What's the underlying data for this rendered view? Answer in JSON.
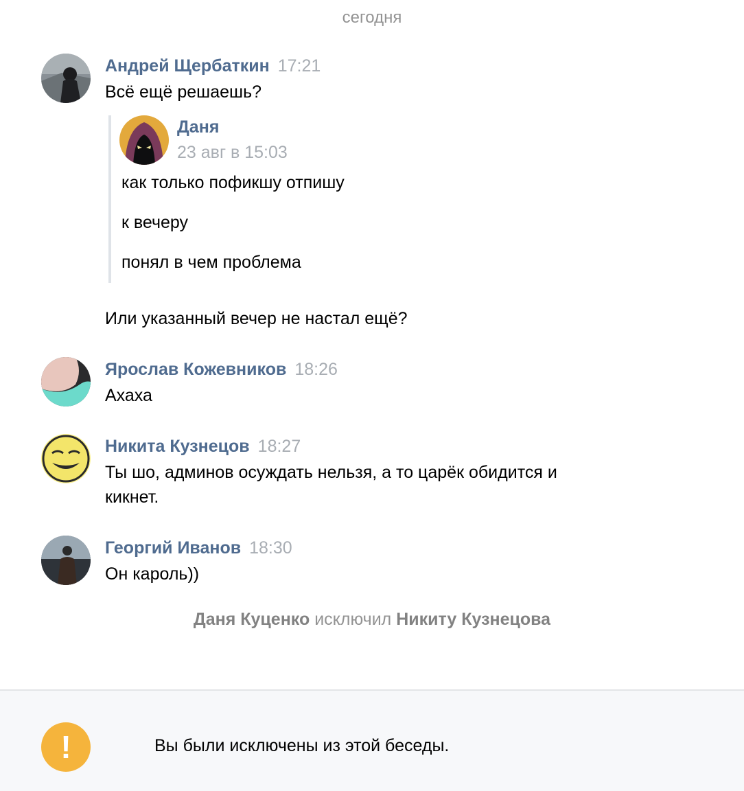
{
  "date_separator": "сегодня",
  "messages": [
    {
      "author": "Андрей Щербаткин",
      "time": "17:21",
      "text": "Всё ещё решаешь?",
      "avatar": "avatar-andrey",
      "forwarded": {
        "author": "Даня",
        "date": "23 авг в 15:03",
        "lines": [
          "как только пофикшу отпишу",
          "к вечеру",
          "понял в чем проблема"
        ],
        "avatar": "avatar-danya"
      },
      "text_after": "Или указанный вечер не настал ещё?"
    },
    {
      "author": "Ярослав Кожевников",
      "time": "18:26",
      "text": "Ахаха",
      "avatar": "avatar-yaroslav"
    },
    {
      "author": "Никита Кузнецов",
      "time": "18:27",
      "text_line1": "Ты шо, админов осуждать нельзя, а то царёк обидится и",
      "text_line2": "кикнет.",
      "avatar": "avatar-nikita"
    },
    {
      "author": "Георгий Иванов",
      "time": "18:30",
      "text": "Он кароль))",
      "avatar": "avatar-georgiy"
    }
  ],
  "service_message": {
    "actor": "Даня Куценко",
    "action": "исключил",
    "target": "Никиту Кузнецова"
  },
  "footer": {
    "icon": "exclamation-icon",
    "text": "Вы были исключены из этой беседы."
  },
  "colors": {
    "author": "#4f6b8f",
    "time": "#a8adb3",
    "warning": "#f5b43c",
    "footer_bg": "#f7f8fa"
  }
}
